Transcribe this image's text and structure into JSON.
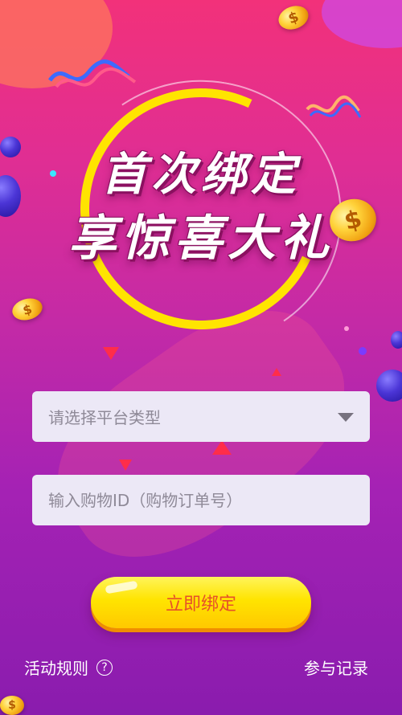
{
  "banner": {
    "line1": "首次绑定",
    "line2": "享惊喜大礼",
    "coin_symbol": "$"
  },
  "form": {
    "platform_select": {
      "placeholder": "请选择平台类型",
      "icon": "caret-down-icon"
    },
    "order_input": {
      "placeholder": "输入购物ID（购物订单号）"
    },
    "submit_label": "立即绑定"
  },
  "footer": {
    "rules_label": "活动规则",
    "help_symbol": "?",
    "records_label": "参与记录"
  },
  "colors": {
    "accent_yellow": "#ffe400",
    "button_text": "#e6502a",
    "background_top": "#f2317a",
    "background_bottom": "#8a1cae"
  }
}
